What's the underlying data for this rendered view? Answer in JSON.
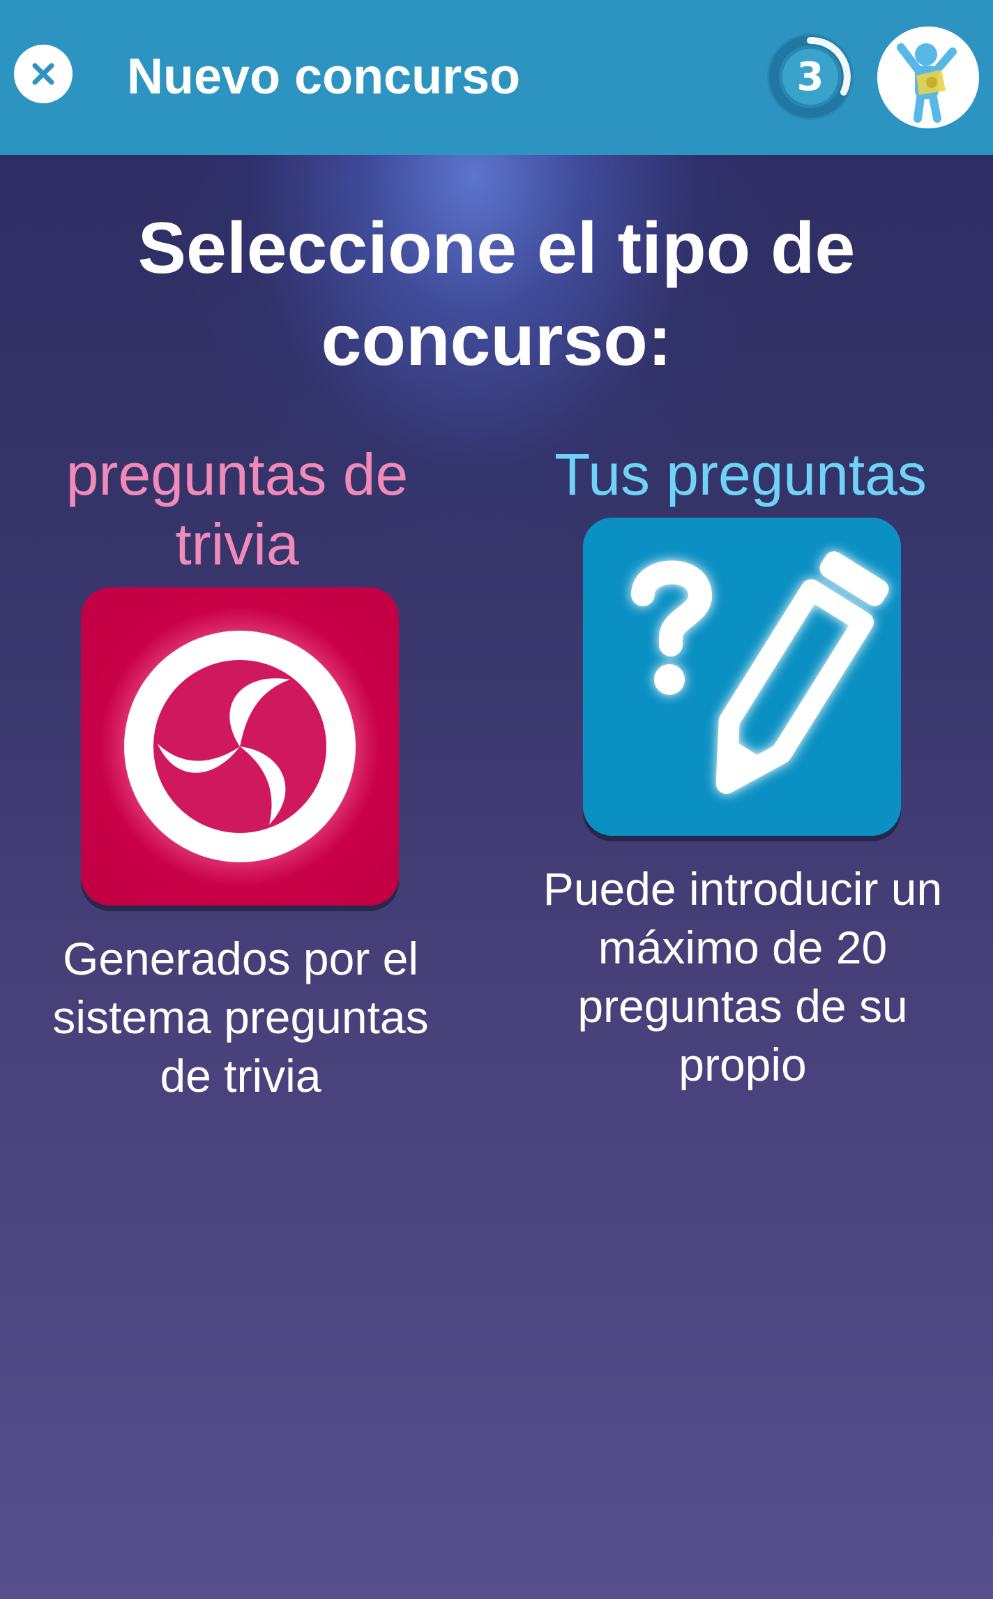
{
  "header": {
    "close_icon": "close-icon",
    "title": "Nuevo concurso",
    "level": "3",
    "avatar_icon": "user-avatar"
  },
  "main": {
    "heading": "Seleccione el tipo de concurso:",
    "options": [
      {
        "label": "preguntas de trivia",
        "icon": "trivia-swirl-icon",
        "description": "Generados por el sistema preguntas de trivia",
        "label_color": "#f08ab8",
        "tile_color": "#c90047"
      },
      {
        "label": "Tus preguntas",
        "icon": "question-pencil-icon",
        "description": "Puede introducir un máximo de 20 preguntas de su propio",
        "label_color": "#6fd2f6",
        "tile_color": "#0b90c4"
      }
    ]
  },
  "colors": {
    "topbar": "#2d93c0",
    "background_top": "#2c2a63",
    "background_bottom": "#564f8c"
  }
}
